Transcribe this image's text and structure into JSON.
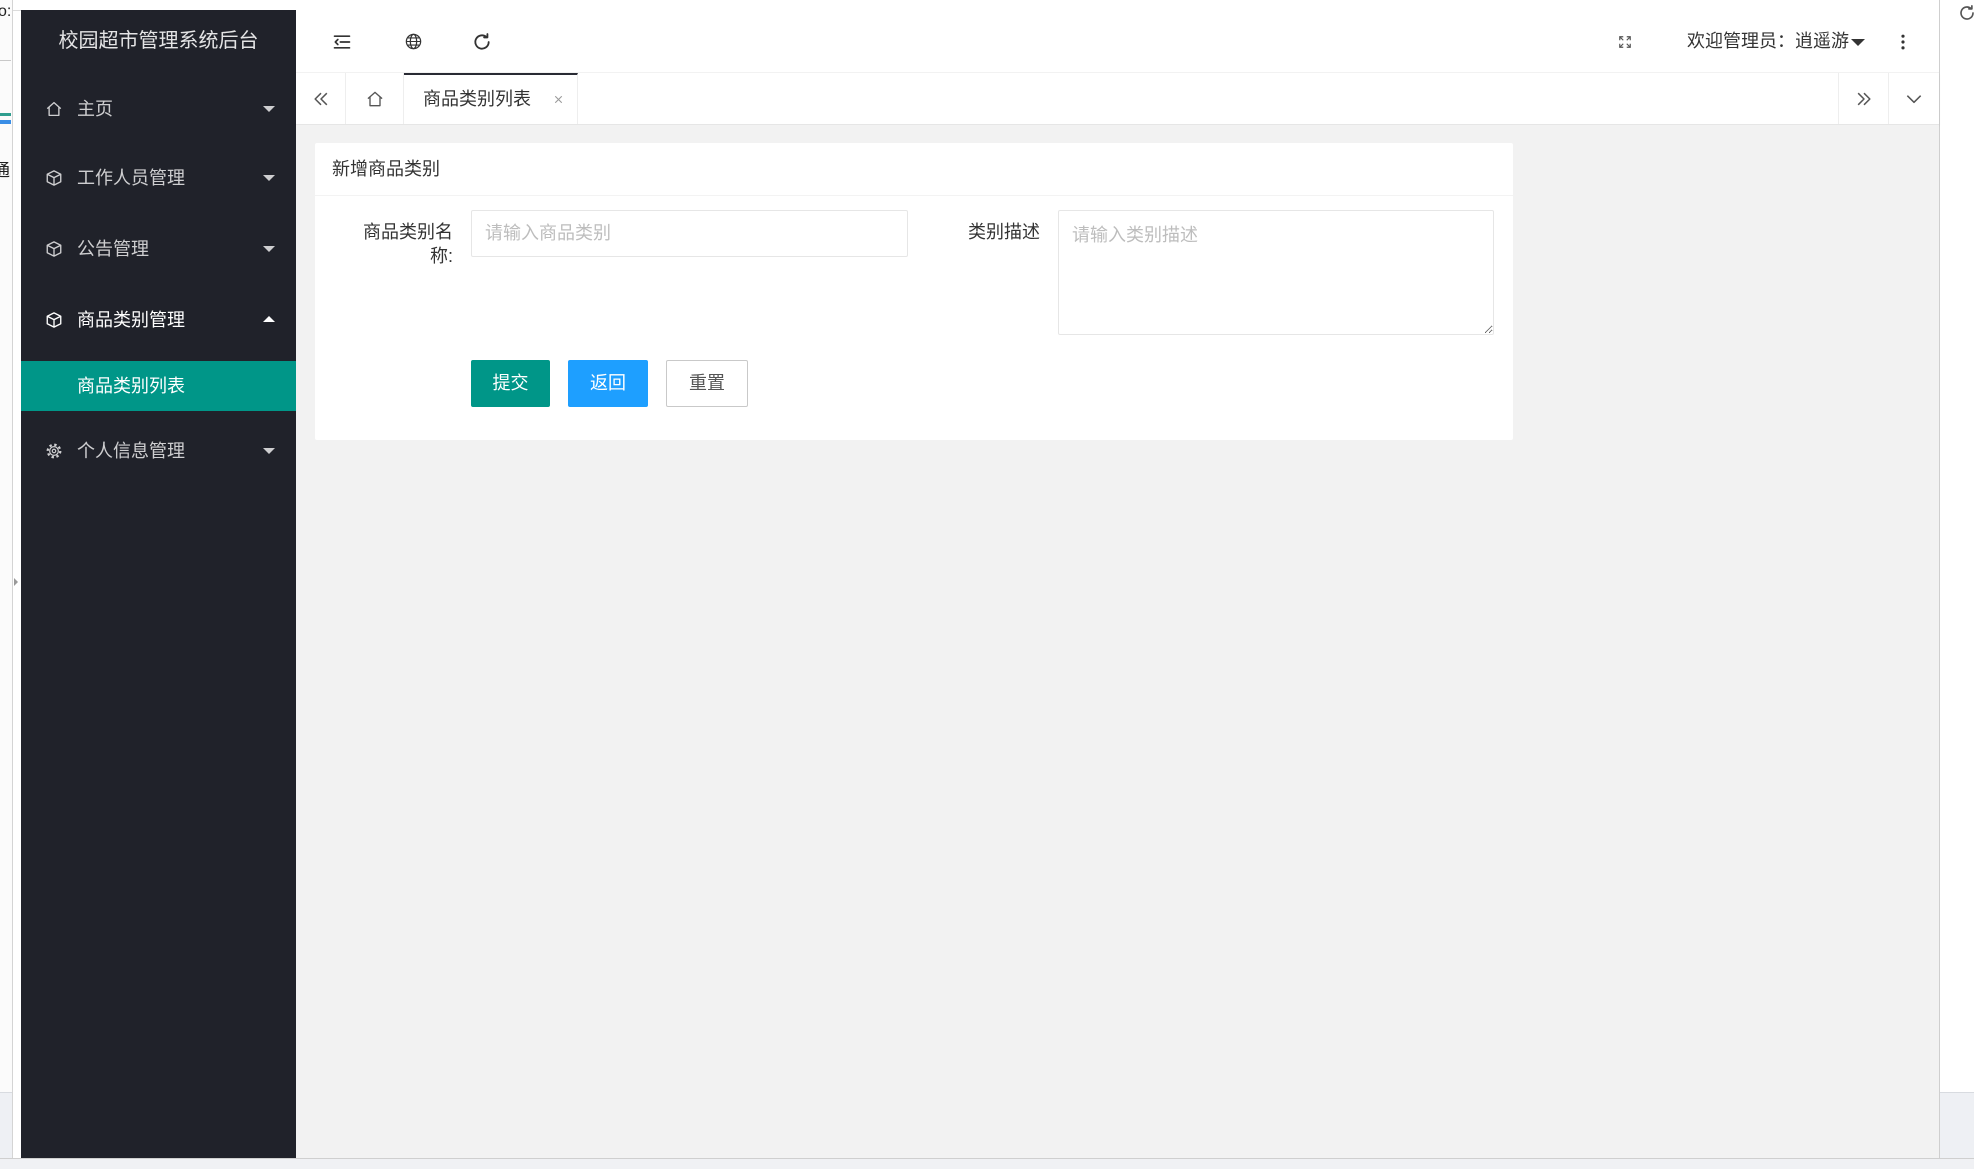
{
  "browser": {
    "left_fragments": {
      "top": "o:",
      "middle": "通"
    },
    "refresh_icon": "refresh-icon"
  },
  "app": {
    "title": "校园超市管理系统后台"
  },
  "sidebar": {
    "items": [
      {
        "id": "home",
        "label": "主页",
        "icon": "home-icon",
        "expanded": false
      },
      {
        "id": "staff",
        "label": "工作人员管理",
        "icon": "cube-icon",
        "expanded": false
      },
      {
        "id": "notice",
        "label": "公告管理",
        "icon": "cube-icon",
        "expanded": false
      },
      {
        "id": "category",
        "label": "商品类别管理",
        "icon": "cube-icon",
        "expanded": true,
        "children": [
          {
            "label": "商品类别列表",
            "active": true
          }
        ]
      },
      {
        "id": "profile",
        "label": "个人信息管理",
        "icon": "gear-icon",
        "expanded": false
      }
    ]
  },
  "header": {
    "left_icons": [
      "shrink-menu-icon",
      "globe-icon",
      "refresh-icon"
    ],
    "right_icons": [
      "fullscreen-icon",
      "more-vertical-icon"
    ],
    "welcome": "欢迎管理员：逍遥游"
  },
  "tabs": {
    "controls": {
      "prev": "double-left-icon",
      "home": "home-icon",
      "next": "double-right-icon",
      "menu": "chevron-down-icon"
    },
    "items": [
      {
        "label": "商品类别列表",
        "active": true,
        "closable": true
      }
    ]
  },
  "form": {
    "title": "新增商品类别",
    "fields": {
      "name": {
        "label": "商品类别名称:",
        "value": "",
        "placeholder": "请输入商品类别"
      },
      "description": {
        "label": "类别描述",
        "value": "",
        "placeholder": "请输入类别描述"
      }
    },
    "buttons": {
      "submit": "提交",
      "back": "返回",
      "reset": "重置"
    }
  },
  "colors": {
    "sidebar_bg": "#20222a",
    "primary": "#009688",
    "normal": "#1e9fff",
    "content_bg": "#f2f2f2",
    "text": "#333333",
    "placeholder": "#bdbdbd"
  }
}
